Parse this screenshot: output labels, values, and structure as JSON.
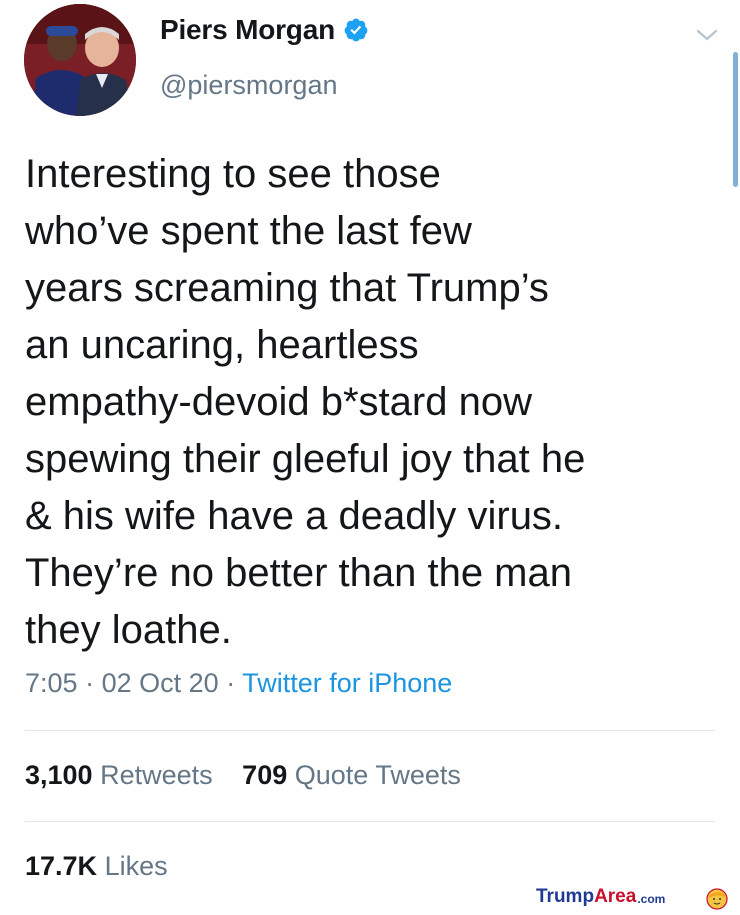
{
  "tweet": {
    "author_name": "Piers Morgan",
    "handle": "@piersmorgan",
    "text": "Interesting to see those\nwho’ve spent the last few\nyears screaming that Trump’s\nan uncaring, heartless\nempathy-devoid b*stard now\nspewing their gleeful joy that he\n& his wife have a deadly virus.\nThey’re no better than the man\nthey loathe.",
    "time": "7:05",
    "date": "02 Oct 20",
    "separator": "·",
    "source": "Twitter for iPhone"
  },
  "stats": {
    "retweets_count": "3,100",
    "retweets_label": "Retweets",
    "quote_count": "709",
    "quote_label": "Quote Tweets",
    "likes_count": "17.7K",
    "likes_label": "Likes"
  },
  "watermark": {
    "trump": "Trump",
    "area": "Area",
    "com": ".com"
  },
  "icons": {
    "verified": "verified-badge-icon",
    "menu": "chevron-down-icon",
    "watermark_logo": "trump-face-icon"
  },
  "colors": {
    "accent": "#1b95e0",
    "secondary_text": "#657786",
    "primary_text": "#14171a",
    "divider": "#e1e8ed"
  }
}
